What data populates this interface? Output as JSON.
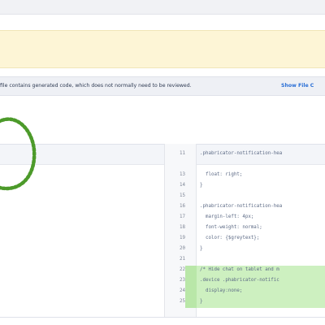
{
  "notice": {
    "text": "file contains generated code, which does not normally need to be reviewed.",
    "link": "Show File C"
  },
  "diff": {
    "header_line_number": "11",
    "header_code": ".phabricator-notification-hea",
    "lines": [
      {
        "num": "13",
        "code": "  float: right;",
        "added": false
      },
      {
        "num": "14",
        "code": "}",
        "added": false
      },
      {
        "num": "15",
        "code": "",
        "added": false
      },
      {
        "num": "16",
        "code": ".phabricator-notification-hea",
        "added": false
      },
      {
        "num": "17",
        "code": "  margin-left: 4px;",
        "added": false
      },
      {
        "num": "18",
        "code": "  font-weight: normal;",
        "added": false
      },
      {
        "num": "19",
        "code": "  color: {$greytext};",
        "added": false
      },
      {
        "num": "20",
        "code": "}",
        "added": false
      },
      {
        "num": "21",
        "code": "",
        "added": false
      },
      {
        "num": "22",
        "code": "/* Hide chat on tablet and m",
        "added": true
      },
      {
        "num": "23",
        "code": ".device .phabricator-notific",
        "added": true
      },
      {
        "num": "24",
        "code": "  display:none;",
        "added": true
      },
      {
        "num": "25",
        "code": "}",
        "added": true
      }
    ]
  },
  "colors": {
    "added_bg": "#cdf0c0",
    "banner_bg": "#fdf5d6",
    "marker": "#4c9a2a"
  }
}
